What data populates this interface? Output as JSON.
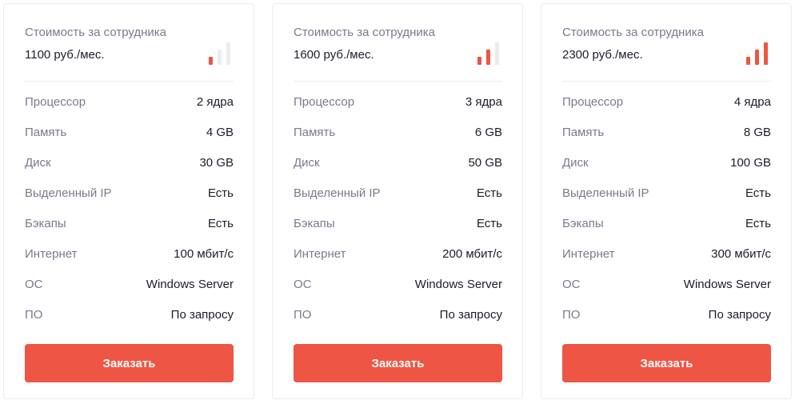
{
  "accent_color": "#ee5544",
  "plans": [
    {
      "cost_label": "Стоимость за сотрудника",
      "price": "1100 руб./мес.",
      "level": 1,
      "level_max": 3,
      "specs": [
        {
          "label": "Процессор",
          "value": "2 ядра"
        },
        {
          "label": "Память",
          "value": "4 GB"
        },
        {
          "label": "Диск",
          "value": "30 GB"
        },
        {
          "label": "Выделенный IP",
          "value": "Есть"
        },
        {
          "label": "Бэкапы",
          "value": "Есть"
        },
        {
          "label": "Интернет",
          "value": "100 мбит/с"
        },
        {
          "label": "ОС",
          "value": "Windows Server"
        },
        {
          "label": "ПО",
          "value": "По запросу"
        }
      ],
      "order_label": "Заказать"
    },
    {
      "cost_label": "Стоимость за сотрудника",
      "price": "1600 руб./мес.",
      "level": 2,
      "level_max": 3,
      "specs": [
        {
          "label": "Процессор",
          "value": "3 ядра"
        },
        {
          "label": "Память",
          "value": "6 GB"
        },
        {
          "label": "Диск",
          "value": "50 GB"
        },
        {
          "label": "Выделенный IP",
          "value": "Есть"
        },
        {
          "label": "Бэкапы",
          "value": "Есть"
        },
        {
          "label": "Интернет",
          "value": "200 мбит/с"
        },
        {
          "label": "ОС",
          "value": "Windows Server"
        },
        {
          "label": "ПО",
          "value": "По запросу"
        }
      ],
      "order_label": "Заказать"
    },
    {
      "cost_label": "Стоимость за сотрудника",
      "price": "2300 руб./мес.",
      "level": 3,
      "level_max": 3,
      "specs": [
        {
          "label": "Процессор",
          "value": "4 ядра"
        },
        {
          "label": "Память",
          "value": "8 GB"
        },
        {
          "label": "Диск",
          "value": "100 GB"
        },
        {
          "label": "Выделенный IP",
          "value": "Есть"
        },
        {
          "label": "Бэкапы",
          "value": "Есть"
        },
        {
          "label": "Интернет",
          "value": "300 мбит/с"
        },
        {
          "label": "ОС",
          "value": "Windows Server"
        },
        {
          "label": "ПО",
          "value": "По запросу"
        }
      ],
      "order_label": "Заказать"
    }
  ]
}
